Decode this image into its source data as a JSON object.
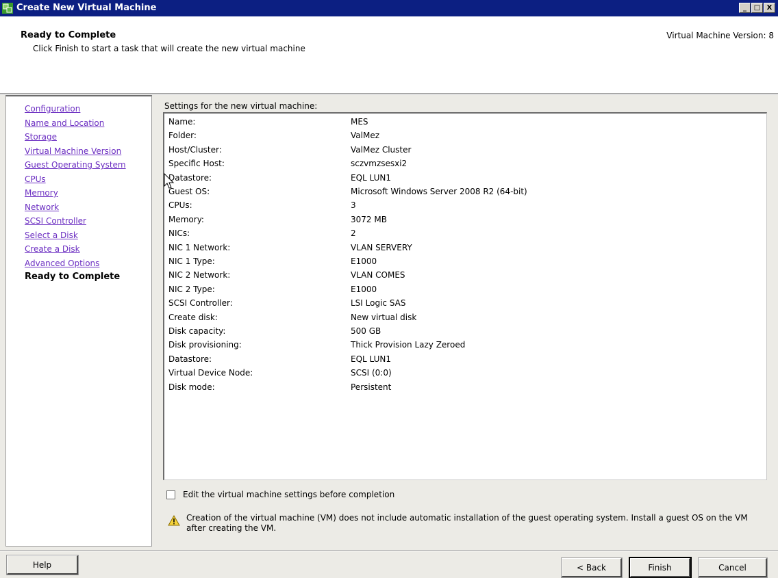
{
  "window": {
    "title": "Create New Virtual Machine",
    "controls": [
      "_",
      "□",
      "X"
    ]
  },
  "header": {
    "title": "Ready to Complete",
    "subtitle": "Click Finish to start a task that will create the new virtual machine",
    "version": "Virtual Machine Version: 8"
  },
  "nav": {
    "items": [
      {
        "label": "Configuration",
        "current": false
      },
      {
        "label": "Name and Location",
        "current": false
      },
      {
        "label": "Storage",
        "current": false
      },
      {
        "label": "Virtual Machine Version",
        "current": false
      },
      {
        "label": "Guest Operating System",
        "current": false
      },
      {
        "label": "CPUs",
        "current": false
      },
      {
        "label": "Memory",
        "current": false
      },
      {
        "label": "Network",
        "current": false
      },
      {
        "label": "SCSI Controller",
        "current": false
      },
      {
        "label": "Select a Disk",
        "current": false
      },
      {
        "label": "Create a Disk",
        "current": false
      },
      {
        "label": "Advanced Options",
        "current": false
      },
      {
        "label": "Ready to Complete",
        "current": true
      }
    ]
  },
  "settings": {
    "label": "Settings for the new virtual machine:",
    "rows": [
      {
        "key": "Name:",
        "value": "MES"
      },
      {
        "key": "Folder:",
        "value": "ValMez"
      },
      {
        "key": "Host/Cluster:",
        "value": "ValMez Cluster"
      },
      {
        "key": "Specific Host:",
        "value": "sczvmzsesxi2"
      },
      {
        "key": "Datastore:",
        "value": "EQL LUN1"
      },
      {
        "key": "Guest OS:",
        "value": "Microsoft Windows Server 2008 R2 (64-bit)"
      },
      {
        "key": "CPUs:",
        "value": "3"
      },
      {
        "key": "Memory:",
        "value": "3072 MB"
      },
      {
        "key": "NICs:",
        "value": "2"
      },
      {
        "key": "NIC 1 Network:",
        "value": "VLAN SERVERY"
      },
      {
        "key": "NIC 1 Type:",
        "value": "E1000"
      },
      {
        "key": "NIC 2 Network:",
        "value": "VLAN COMES"
      },
      {
        "key": "NIC 2 Type:",
        "value": "E1000"
      },
      {
        "key": "SCSI Controller:",
        "value": "LSI Logic SAS"
      },
      {
        "key": "Create disk:",
        "value": "New virtual disk"
      },
      {
        "key": "Disk capacity:",
        "value": "500 GB"
      },
      {
        "key": "Disk provisioning:",
        "value": "Thick Provision Lazy Zeroed"
      },
      {
        "key": "Datastore:",
        "value": "EQL LUN1"
      },
      {
        "key": "Virtual Device Node:",
        "value": "SCSI (0:0)"
      },
      {
        "key": "Disk mode:",
        "value": "Persistent"
      }
    ]
  },
  "edit_checkbox": {
    "label": "Edit the virtual machine settings before completion",
    "checked": false
  },
  "warning": {
    "text": "Creation of the virtual machine (VM) does not include automatic installation of the guest operating system. Install a guest OS on the VM after creating the VM."
  },
  "buttons": {
    "help": "Help",
    "back": "< Back",
    "finish": "Finish",
    "cancel": "Cancel"
  }
}
